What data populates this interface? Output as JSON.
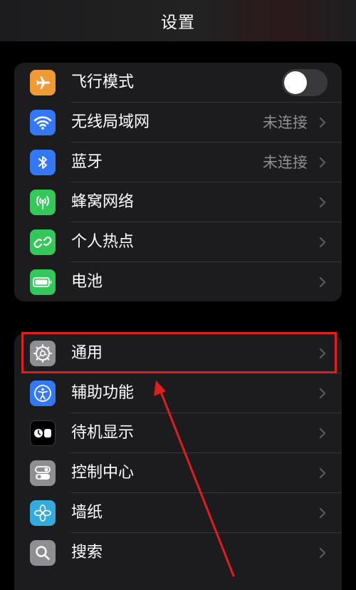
{
  "header": {
    "title": "设置"
  },
  "group1": {
    "items": [
      {
        "label": "飞行模式",
        "icon": "airplane-icon",
        "color": "#f09a37",
        "toggle": false
      },
      {
        "label": "无线局域网",
        "value": "未连接",
        "icon": "wifi-icon",
        "color": "#3478f6"
      },
      {
        "label": "蓝牙",
        "value": "未连接",
        "icon": "bluetooth-icon",
        "color": "#3478f6"
      },
      {
        "label": "蜂窝网络",
        "icon": "cellular-icon",
        "color": "#34c759"
      },
      {
        "label": "个人热点",
        "icon": "hotspot-icon",
        "color": "#34c759"
      },
      {
        "label": "电池",
        "icon": "battery-icon",
        "color": "#34c759"
      }
    ]
  },
  "group2": {
    "items": [
      {
        "label": "通用",
        "icon": "gear-icon",
        "color": "#8e8e93"
      },
      {
        "label": "辅助功能",
        "icon": "accessibility-icon",
        "color": "#3478f6"
      },
      {
        "label": "待机显示",
        "icon": "standby-icon",
        "color": "#000000"
      },
      {
        "label": "控制中心",
        "icon": "control-center-icon",
        "color": "#8e8e93"
      },
      {
        "label": "墙纸",
        "icon": "wallpaper-icon",
        "color": "#35aadc"
      },
      {
        "label": "搜索",
        "icon": "search-icon",
        "color": "#8e8e93"
      }
    ]
  },
  "annotation": {
    "highlight_color": "#e01e1e"
  }
}
